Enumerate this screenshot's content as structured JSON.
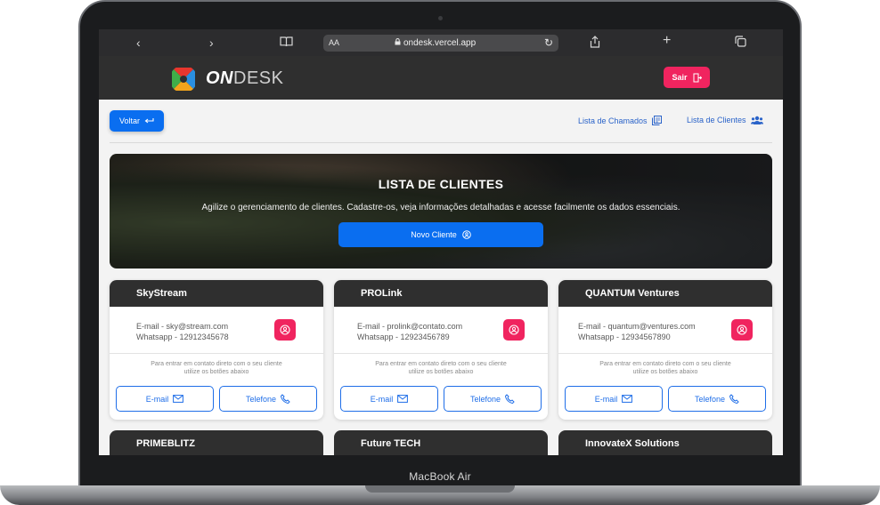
{
  "device_label": "MacBook Air",
  "browser": {
    "aa_label": "AA",
    "url": "ondesk.vercel.app"
  },
  "header": {
    "brand_bold": "ON",
    "brand_light": "DESK",
    "logout_label": "Sair"
  },
  "nav": {
    "back_label": "Voltar",
    "links": [
      {
        "label": "Lista de Chamados",
        "icon": "list-icon"
      },
      {
        "label": "Lista de Clientes",
        "icon": "users-icon"
      }
    ]
  },
  "hero": {
    "title": "LISTA DE CLIENTES",
    "subtitle": "Agilize o gerenciamento de clientes. Cadastre-os, veja informações detalhadas e acesse facilmente os dados essenciais.",
    "new_button_label": "Novo Cliente"
  },
  "clients": [
    {
      "name": "SkyStream",
      "email": "E-mail - sky@stream.com",
      "whatsapp": "Whatsapp - 12912345678"
    },
    {
      "name": "PROLink",
      "email": "E-mail - prolink@contato.com",
      "whatsapp": "Whatsapp - 12923456789"
    },
    {
      "name": "QUANTUM Ventures",
      "email": "E-mail - quantum@ventures.com",
      "whatsapp": "Whatsapp - 12934567890"
    }
  ],
  "card_common": {
    "note_line1": "Para entrar em contato direto com o seu cliente",
    "note_line2": "utilize os botões abaixo",
    "email_label": "E-mail",
    "phone_label": "Telefone"
  },
  "clients_partial": [
    {
      "name": "PRIMEBLITZ"
    },
    {
      "name": "Future TECH"
    },
    {
      "name": "InnovateX Solutions"
    }
  ],
  "colors": {
    "accent_blue": "#0a6ef0",
    "accent_pink": "#f0245f",
    "header_dark": "#2f2f2f"
  }
}
